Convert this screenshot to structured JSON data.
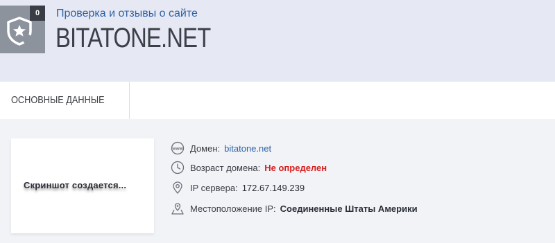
{
  "header": {
    "badge_count": "0",
    "subtitle": "Проверка и отзывы о сайте",
    "site_name": "BITATONE.NET",
    "icon": "shield-star-icon"
  },
  "tabs": [
    {
      "label": "ОСНОВНЫЕ ДАННЫЕ"
    }
  ],
  "screenshot": {
    "placeholder_text": "Скриншот создается..."
  },
  "info": [
    {
      "icon": "globe-www-icon",
      "label": "Домен:",
      "value": "bitatone.net"
    },
    {
      "icon": "clock-icon",
      "label": "Возраст домена:",
      "value": "Не определен"
    },
    {
      "icon": "location-pin-icon",
      "label": "IP сервера:",
      "value": "172.67.149.239"
    },
    {
      "icon": "map-location-icon",
      "label": "Местоположение IP:",
      "value": "Соединенные Штаты Америки"
    }
  ],
  "colors": {
    "link": "#2f62a6",
    "warning": "#d61f1f",
    "shield_bg": "#8d939d",
    "header_bg": "#e6e9f3"
  }
}
